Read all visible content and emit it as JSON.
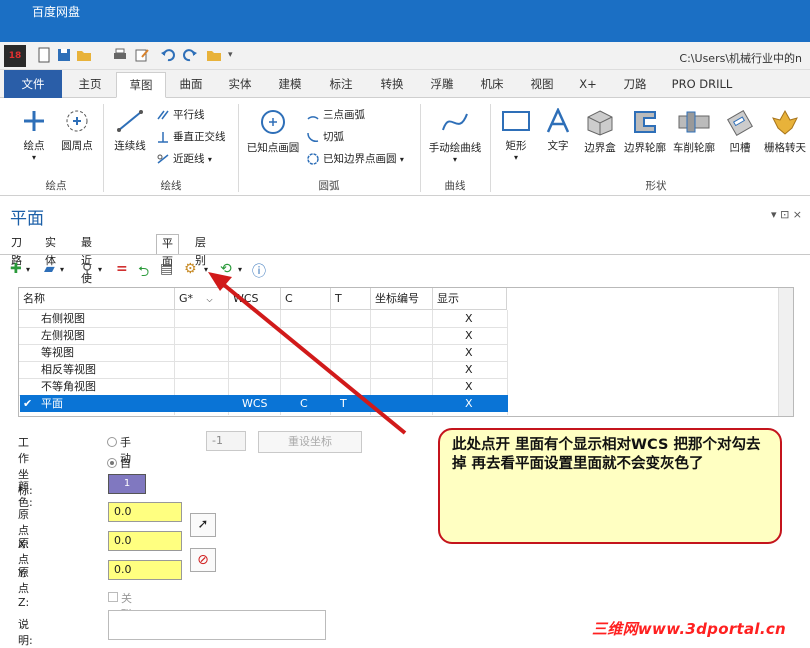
{
  "window": {
    "title": "百度网盘",
    "path": "C:\\Users\\机械行业中的n"
  },
  "app_badge": "18",
  "ribbon_tabs": [
    "文件",
    "主页",
    "草图",
    "曲面",
    "实体",
    "建模",
    "标注",
    "转换",
    "浮雕",
    "机床",
    "视图",
    "X+",
    "刀路",
    "PRO DRILL"
  ],
  "ribbon": {
    "point_group": {
      "label": "绘点",
      "buttons": [
        "绘点",
        "圆周点"
      ]
    },
    "line_group": {
      "label": "绘线",
      "big": "连续线",
      "small": [
        "平行线",
        "垂直正交线",
        "近距线"
      ]
    },
    "arc_group": {
      "label": "圆弧",
      "big": "已知点画圆",
      "small": [
        "三点画弧",
        "切弧",
        "已知边界点画圆"
      ]
    },
    "curve_group": {
      "label": "曲线",
      "big": "手动绘曲线"
    },
    "shape_group": {
      "label": "形状",
      "buttons": [
        "矩形",
        "文字",
        "边界盒",
        "边界轮廓",
        "车削轮廓",
        "凹槽",
        "栅格转天"
      ]
    }
  },
  "panel": {
    "title": "平面",
    "controls": "▾ ⊡ ×",
    "tabs": [
      "刀路",
      "实体",
      "最近使用功能",
      "平面",
      "层别"
    ],
    "grid": {
      "headers": [
        "名称",
        "G*",
        "WCS",
        "C",
        "T",
        "坐标编号",
        "显示"
      ],
      "rows": [
        {
          "name": "右侧视图",
          "g": "",
          "wcs": "",
          "c": "",
          "t": "",
          "num": "",
          "show": "X"
        },
        {
          "name": "左侧视图",
          "g": "",
          "wcs": "",
          "c": "",
          "t": "",
          "num": "",
          "show": "X"
        },
        {
          "name": "等视图",
          "g": "",
          "wcs": "",
          "c": "",
          "t": "",
          "num": "",
          "show": "X"
        },
        {
          "name": "相反等视图",
          "g": "",
          "wcs": "",
          "c": "",
          "t": "",
          "num": "",
          "show": "X"
        },
        {
          "name": "不等角视图",
          "g": "",
          "wcs": "",
          "c": "",
          "t": "",
          "num": "",
          "show": "X"
        },
        {
          "name": "平面",
          "g": "",
          "wcs": "WCS",
          "c": "C",
          "t": "T",
          "num": "",
          "show": "X"
        }
      ]
    }
  },
  "form": {
    "work_coord_label": "工作坐标:",
    "manual": "手动",
    "auto": "自动",
    "coord_num_value": "-1",
    "reset_button": "重设坐标",
    "color_label": "颜色:",
    "color_value": "1",
    "origin_x_label": "原点 X:",
    "origin_y_label": "原点 Y:",
    "origin_z_label": "原点 Z:",
    "origin_x": "0.0",
    "origin_y": "0.0",
    "origin_z": "0.0",
    "associate_label": "关联",
    "description_label": "说明:"
  },
  "annotation": {
    "text": "此处点开 里面有个显示相对WCS 把那个对勾去掉 再去看平面设置里面就不会变灰色了",
    "arrow_color": "#d11a1a",
    "box_bg": "#ffffc2"
  },
  "watermark": "三维网www.3dportal.cn",
  "colors": {
    "titlebar": "#1b6fc4",
    "file_tab": "#2a5ea8",
    "selection": "#0a74d6",
    "input_bg": "#ffff80",
    "color_swatch": "#8078c0"
  }
}
